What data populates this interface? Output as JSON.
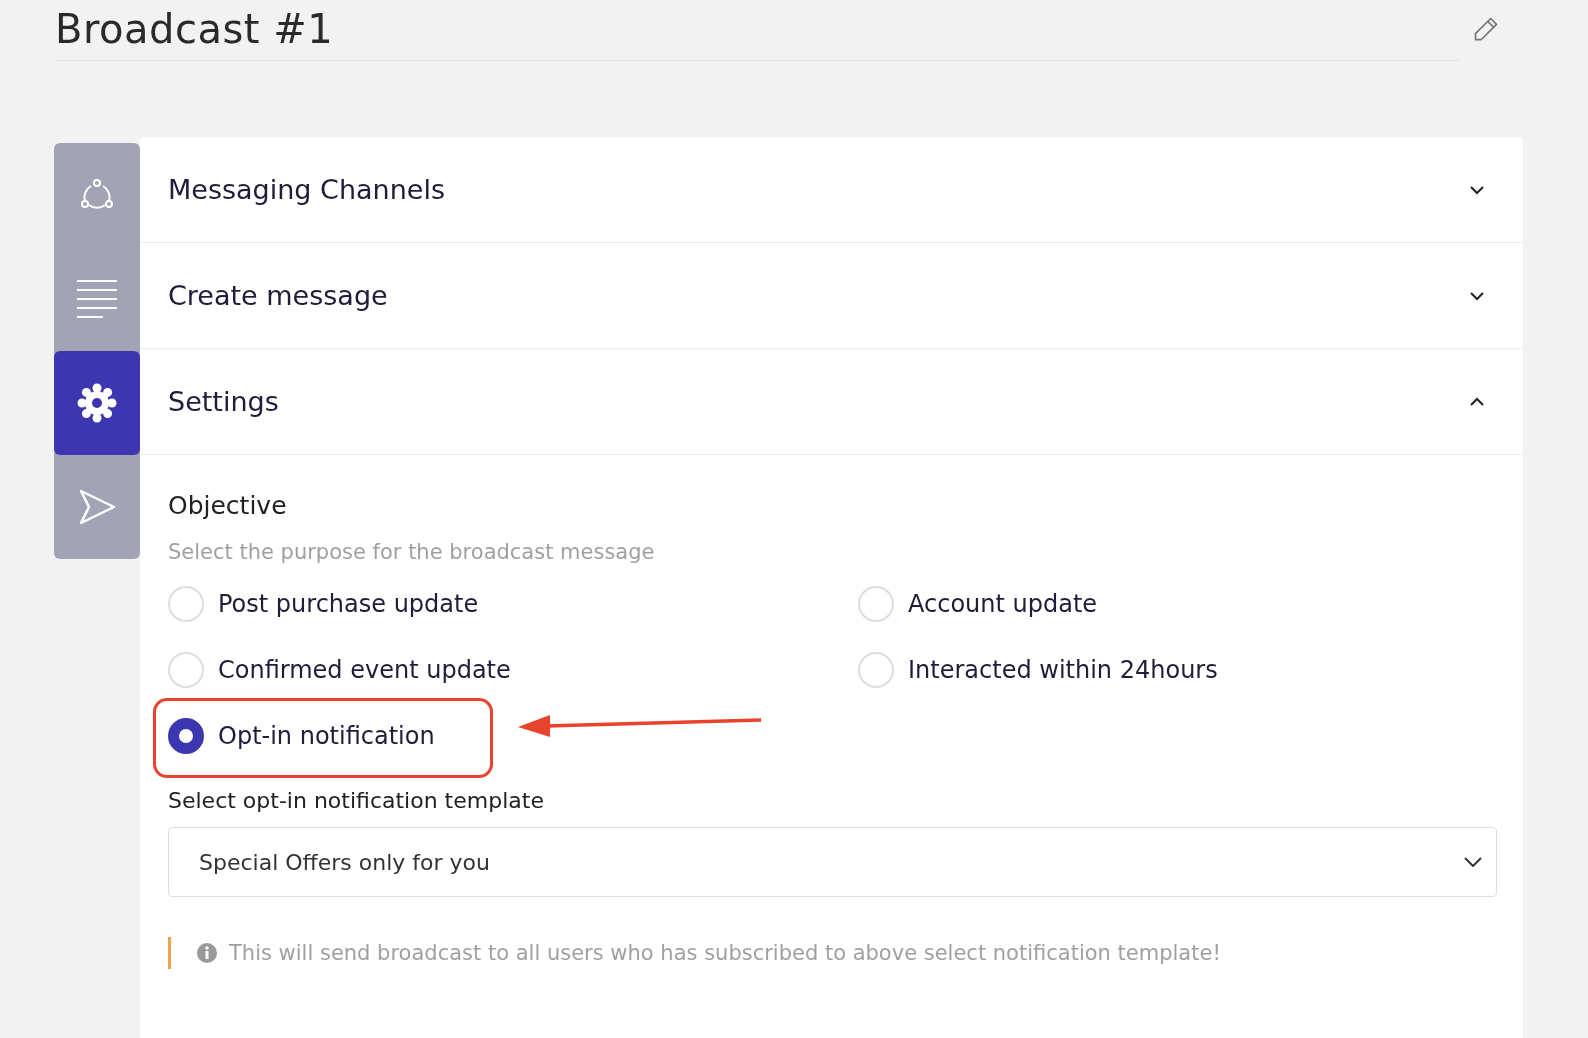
{
  "title": "Broadcast #1",
  "sidebar": {
    "items": [
      {
        "kind": "channels",
        "selected": false
      },
      {
        "kind": "message",
        "selected": false
      },
      {
        "kind": "settings",
        "selected": true
      },
      {
        "kind": "send",
        "selected": false
      }
    ]
  },
  "sections": [
    {
      "title": "Messaging Channels",
      "expanded": false
    },
    {
      "title": "Create message",
      "expanded": false
    },
    {
      "title": "Settings",
      "expanded": true
    }
  ],
  "objective": {
    "title": "Objective",
    "subtitle": "Select the purpose for the broadcast message",
    "options": [
      {
        "label": "Post purchase update",
        "selected": false
      },
      {
        "label": "Account update",
        "selected": false
      },
      {
        "label": "Confirmed event update",
        "selected": false
      },
      {
        "label": "Interacted within 24hours",
        "selected": false
      },
      {
        "label": "Opt-in notification",
        "selected": true
      }
    ]
  },
  "template": {
    "label": "Select opt-in notification template",
    "value": "Special Offers only for you"
  },
  "note": "This will send broadcast to all users who has subscribed to above select notification template!"
}
